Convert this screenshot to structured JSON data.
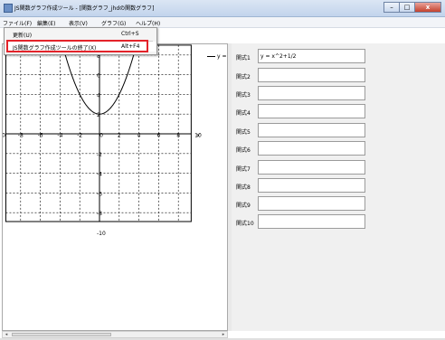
{
  "window": {
    "title": "JS関数グラフ作成ツール - [関数グラフ_jhdの関数グラフ]",
    "minimize_glyph": "–",
    "maximize_glyph": "□",
    "close_glyph": "x"
  },
  "menubar": {
    "items": [
      "ファイル(F)",
      "編集(E)",
      "表示(V)",
      "グラフ(G)",
      "ヘルプ(H)"
    ]
  },
  "dropdown": {
    "items": [
      {
        "label": "更新(U)",
        "shortcut": "Ctrl+S"
      },
      {
        "label": "JS関数グラフ作成ツールの終了(X)",
        "shortcut": "Alt+F4"
      }
    ]
  },
  "graph": {
    "legend_label": "y =",
    "x_axis_label": "x",
    "x_ticks": [
      "-10",
      "-8",
      "-6",
      "-4",
      "-2",
      "0",
      "2",
      "4",
      "6",
      "8",
      "10"
    ],
    "y_ticks": [
      "8",
      "6",
      "4",
      "2",
      "-2",
      "-4",
      "-6",
      "-8",
      "-10"
    ],
    "curve": {
      "a": 0.5,
      "b": 0,
      "c": 2
    },
    "curve_color": "#000000"
  },
  "formulas": [
    {
      "label": "関式1",
      "value": "y = x^2+1/2"
    },
    {
      "label": "関式2",
      "value": ""
    },
    {
      "label": "関式3",
      "value": ""
    },
    {
      "label": "関式4",
      "value": ""
    },
    {
      "label": "関式5",
      "value": ""
    },
    {
      "label": "関式6",
      "value": ""
    },
    {
      "label": "関式7",
      "value": ""
    },
    {
      "label": "関式8",
      "value": ""
    },
    {
      "label": "関式9",
      "value": ""
    },
    {
      "label": "関式10",
      "value": ""
    }
  ],
  "scrollbar": {
    "left_arrow": "◂",
    "right_arrow": "▸"
  }
}
